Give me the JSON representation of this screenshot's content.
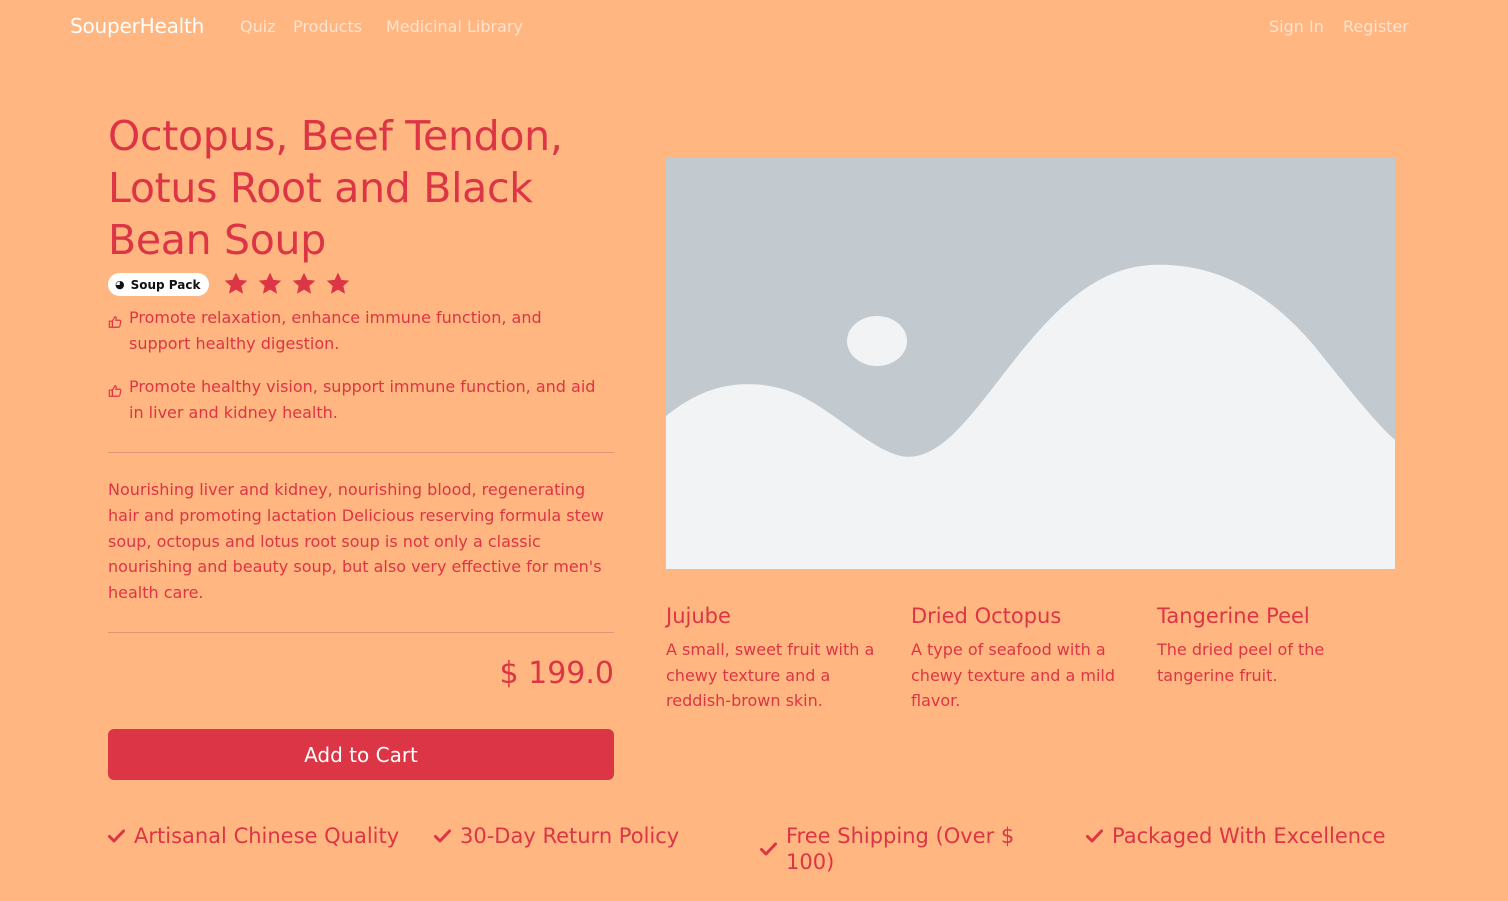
{
  "nav": {
    "brand": "SouperHealth",
    "links": [
      "Quiz",
      "Products",
      "Medicinal Library"
    ],
    "sign_in": "Sign In",
    "register": "Register"
  },
  "product": {
    "title": "Octopus, Beef Tendon, Lotus Root and Black Bean Soup",
    "badge": "Soup Pack",
    "badge_icon": "soup-bowl-icon",
    "rating": 4,
    "rating_max": 4,
    "benefits": [
      "Promote relaxation, enhance immune function, and support healthy digestion.",
      "Promote healthy vision, support immune function, and aid in liver and kidney health."
    ],
    "description": "Nourishing liver and kidney, nourishing blood, regenerating hair and promoting lactation Delicious reserving formula stew soup, octopus and lotus root soup is not only a classic nourishing and beauty soup, but also very effective for men's health care.",
    "price": "$ 199.0",
    "add_to_cart": "Add to Cart"
  },
  "ingredients": [
    {
      "name": "Jujube",
      "description": "A small, sweet fruit with a chewy texture and a reddish-brown skin."
    },
    {
      "name": "Dried Octopus",
      "description": "A type of seafood with a chewy texture and a mild flavor."
    },
    {
      "name": "Tangerine Peel",
      "description": "The dried peel of the tangerine fruit."
    }
  ],
  "features": [
    "Artisanal Chinese Quality",
    "30-Day Return Policy",
    "Free Shipping (Over $ 100)",
    "Packaged With Excellence"
  ],
  "colors": {
    "background": "#FFB680",
    "accent": "#DC3545",
    "image_sky": "#C3CACF",
    "image_hill": "#F1F3F5",
    "brand_text": "#FFFFFF"
  }
}
